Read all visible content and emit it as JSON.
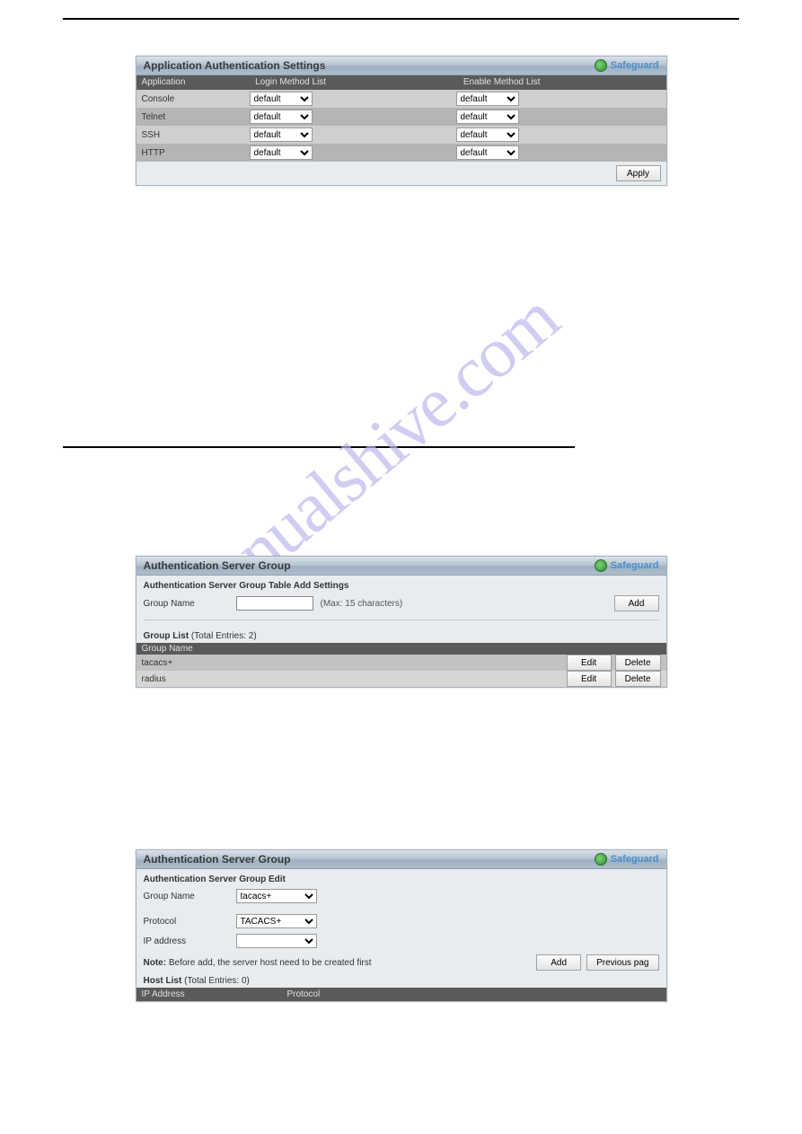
{
  "watermark": "manualshive.com",
  "panel1": {
    "title": "Application Authentication Settings",
    "safeguard": "Safeguard",
    "headers": {
      "app": "Application",
      "login": "Login Method List",
      "enable": "Enable Method List"
    },
    "rows": [
      {
        "app": "Console",
        "login": "default",
        "enable": "default"
      },
      {
        "app": "Telnet",
        "login": "default",
        "enable": "default"
      },
      {
        "app": "SSH",
        "login": "default",
        "enable": "default"
      },
      {
        "app": "HTTP",
        "login": "default",
        "enable": "default"
      }
    ],
    "apply": "Apply"
  },
  "panel2": {
    "title": "Authentication Server Group",
    "safeguard": "Safeguard",
    "add_section": "Authentication Server Group Table Add Settings",
    "group_name_label": "Group Name",
    "max_hint": "(Max: 15 characters)",
    "add": "Add",
    "list_label": "Group List",
    "total_entries": "(Total Entries: 2)",
    "col_group_name": "Group Name",
    "rows": [
      {
        "name": "tacacs+"
      },
      {
        "name": "radius"
      }
    ],
    "edit": "Edit",
    "delete": "Delete"
  },
  "panel3": {
    "title": "Authentication Server Group",
    "safeguard": "Safeguard",
    "edit_section": "Authentication Server Group Edit",
    "group_name_label": "Group Name",
    "group_name_value": "tacacs+",
    "protocol_label": "Protocol",
    "protocol_value": "TACACS+",
    "ip_label": "IP address",
    "ip_value": "",
    "note_label": "Note:",
    "note_text": "Before add, the server host need to be created first",
    "add": "Add",
    "prev": "Previous pag",
    "hostlist_label": "Host List",
    "hostlist_total": "(Total Entries: 0)",
    "col_ip": "IP Address",
    "col_proto": "Protocol"
  }
}
